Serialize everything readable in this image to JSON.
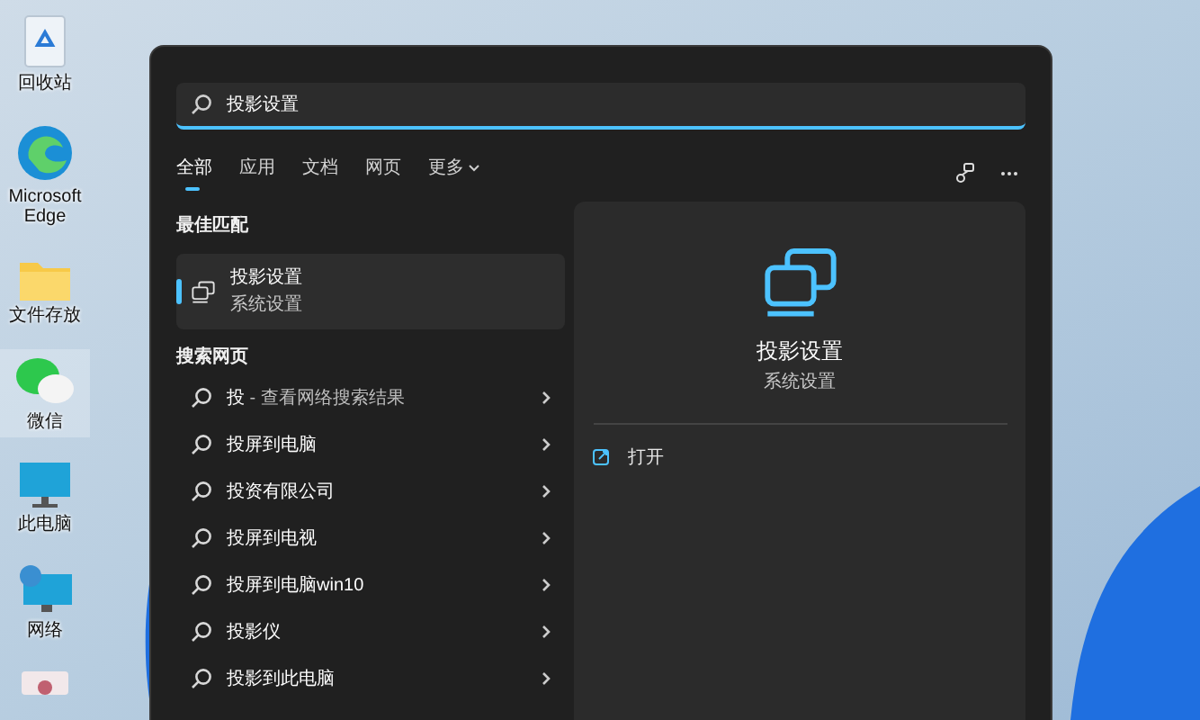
{
  "desktop_icons": [
    {
      "kind": "recycle",
      "label": "回收站",
      "selected": false
    },
    {
      "kind": "edge",
      "label": "Microsoft Edge",
      "selected": false
    },
    {
      "kind": "folder",
      "label": "文件存放",
      "selected": false
    },
    {
      "kind": "wechat",
      "label": "微信",
      "selected": true
    },
    {
      "kind": "pc",
      "label": "此电脑",
      "selected": false
    },
    {
      "kind": "network",
      "label": "网络",
      "selected": false
    },
    {
      "kind": "app",
      "selected": false
    }
  ],
  "search": {
    "value": "投影设置"
  },
  "tabs": [
    {
      "label": "全部",
      "selected": true
    },
    {
      "label": "应用",
      "selected": false
    },
    {
      "label": "文档",
      "selected": false
    },
    {
      "label": "网页",
      "selected": false
    },
    {
      "label": "更多",
      "selected": false,
      "dropdown": true
    }
  ],
  "best_match": {
    "heading": "最佳匹配",
    "title": "投影设置",
    "subtitle": "系统设置",
    "selected": true
  },
  "web_search": {
    "heading": "搜索网页",
    "items": [
      {
        "text": "投",
        "detail": " - 查看网络搜索结果"
      },
      {
        "text": "投屏到电脑"
      },
      {
        "text": "投资有限公司"
      },
      {
        "text": "投屏到电视"
      },
      {
        "text": "投屏到电脑win10"
      },
      {
        "text": "投影仪"
      },
      {
        "text": "投影到此电脑"
      }
    ]
  },
  "preview": {
    "title": "投影设置",
    "subtitle": "系统设置",
    "actions": [
      {
        "label": "打开"
      }
    ]
  }
}
